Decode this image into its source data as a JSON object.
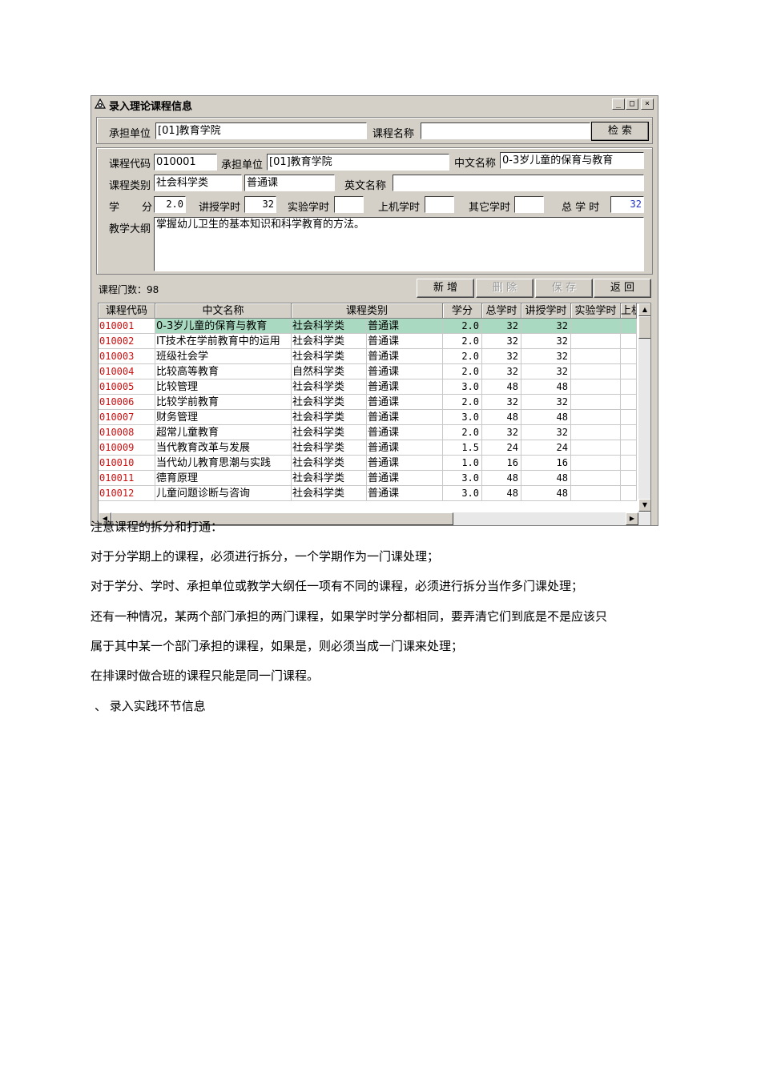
{
  "window": {
    "title": "录入理论课程信息",
    "controls": [
      "_",
      "□",
      "×"
    ]
  },
  "search": {
    "unit_label": "承担单位",
    "unit_value": "[01]教育学院",
    "course_name_label": "课程名称",
    "course_name_value": "",
    "search_button": "检 索"
  },
  "detail": {
    "code_label": "课程代码",
    "code_value": "010001",
    "unit_label": "承担单位",
    "unit_value": "[01]教育学院",
    "cn_name_label": "中文名称",
    "cn_name_value": "0-3岁儿童的保育与教育",
    "category_label": "课程类别",
    "category_value": "社会科学类",
    "category_type_value": "普通课",
    "en_name_label": "英文名称",
    "en_name_value": "",
    "credit_label_a": "学",
    "credit_label_b": "分",
    "credit_value": "2.0",
    "lecture_label": "讲授学时",
    "lecture_value": "32",
    "lab_label": "实验学时",
    "lab_value": "",
    "computer_label": "上机学时",
    "computer_value": "",
    "other_label": "其它学时",
    "other_value": "",
    "total_label": "总 学 时",
    "total_value": "32",
    "syllabus_label": "教学大纲",
    "syllabus_value": "掌握幼儿卫生的基本知识和科学教育的方法。"
  },
  "toolbar": {
    "count_text": "课程门数：98",
    "new_button": "新 增",
    "delete_button": "删 除",
    "save_button": "保 存",
    "back_button": "返 回"
  },
  "table": {
    "headers": [
      "课程代码",
      "中文名称",
      "课程类别",
      "学分",
      "总学时",
      "讲授学时",
      "实验学时",
      "上机"
    ],
    "rows": [
      [
        "010001",
        "0-3岁儿童的保育与教育",
        "社会科学类",
        "普通课",
        "2.0",
        "32",
        "32"
      ],
      [
        "010002",
        "IT技术在学前教育中的运用",
        "社会科学类",
        "普通课",
        "2.0",
        "32",
        "32"
      ],
      [
        "010003",
        "班级社会学",
        "社会科学类",
        "普通课",
        "2.0",
        "32",
        "32"
      ],
      [
        "010004",
        "比较高等教育",
        "自然科学类",
        "普通课",
        "2.0",
        "32",
        "32"
      ],
      [
        "010005",
        "比较管理",
        "社会科学类",
        "普通课",
        "3.0",
        "48",
        "48"
      ],
      [
        "010006",
        "比较学前教育",
        "社会科学类",
        "普通课",
        "2.0",
        "32",
        "32"
      ],
      [
        "010007",
        "财务管理",
        "社会科学类",
        "普通课",
        "3.0",
        "48",
        "48"
      ],
      [
        "010008",
        "超常儿童教育",
        "社会科学类",
        "普通课",
        "2.0",
        "32",
        "32"
      ],
      [
        "010009",
        "当代教育改革与发展",
        "社会科学类",
        "普通课",
        "1.5",
        "24",
        "24"
      ],
      [
        "010010",
        "当代幼儿教育思潮与实践",
        "社会科学类",
        "普通课",
        "1.0",
        "16",
        "16"
      ],
      [
        "010011",
        "德育原理",
        "社会科学类",
        "普通课",
        "3.0",
        "48",
        "48"
      ],
      [
        "010012",
        "儿童问题诊断与咨询",
        "社会科学类",
        "普通课",
        "3.0",
        "48",
        "48"
      ]
    ],
    "selected_row": 0
  },
  "document": {
    "heading": "注意课程的拆分和打通：",
    "lines": [
      "对于分学期上的课程，必须进行拆分，一个学期作为一门课处理；",
      "对于学分、学时、承担单位或教学大纲任一项有不同的课程，必须进行拆分当作多门课处理；",
      "还有一种情况，某两个部门承担的两门课程，如果学时学分都相同，要弄清它们到底是不是应该只",
      "属于其中某一个部门承担的课程，如果是，则必须当成一门课来处理；",
      "在排课时做合班的课程只能是同一门课程。",
      "、 录入实践环节信息"
    ]
  }
}
